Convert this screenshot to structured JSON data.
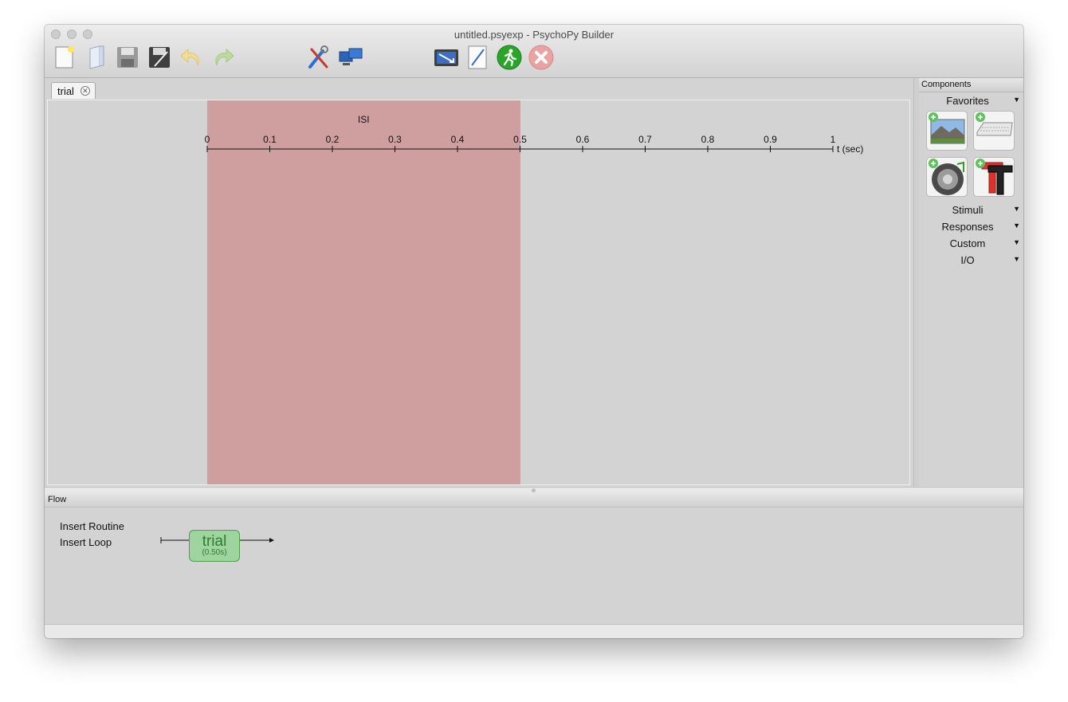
{
  "window": {
    "title": "untitled.psyexp - PsychoPy Builder"
  },
  "routine_tab": {
    "label": "trial",
    "close_glyph": "✕"
  },
  "timeline": {
    "component_name": "ISI",
    "ticks": [
      "0",
      "0.1",
      "0.2",
      "0.3",
      "0.4",
      "0.5",
      "0.6",
      "0.7",
      "0.8",
      "0.9",
      "1"
    ],
    "unit_label": "t (sec)",
    "isi_start": 0,
    "isi_end": 0.5,
    "band_color": "#cf9e9e"
  },
  "components": {
    "header": "Components",
    "favorites_label": "Favorites",
    "favorites": [
      {
        "name": "image-component",
        "icon": "image-icon"
      },
      {
        "name": "keyboard-component",
        "icon": "keyboard-icon"
      },
      {
        "name": "sound-component",
        "icon": "speaker-icon"
      },
      {
        "name": "text-component",
        "icon": "text-T-icon"
      }
    ],
    "categories": [
      "Stimuli",
      "Responses",
      "Custom",
      "I/O"
    ],
    "arrow": "▼"
  },
  "flow": {
    "header": "Flow",
    "insert_routine": "Insert Routine",
    "insert_loop": "Insert Loop",
    "routine": {
      "name": "trial",
      "duration": "(0.50s)",
      "fill": "#9fd39f"
    }
  }
}
